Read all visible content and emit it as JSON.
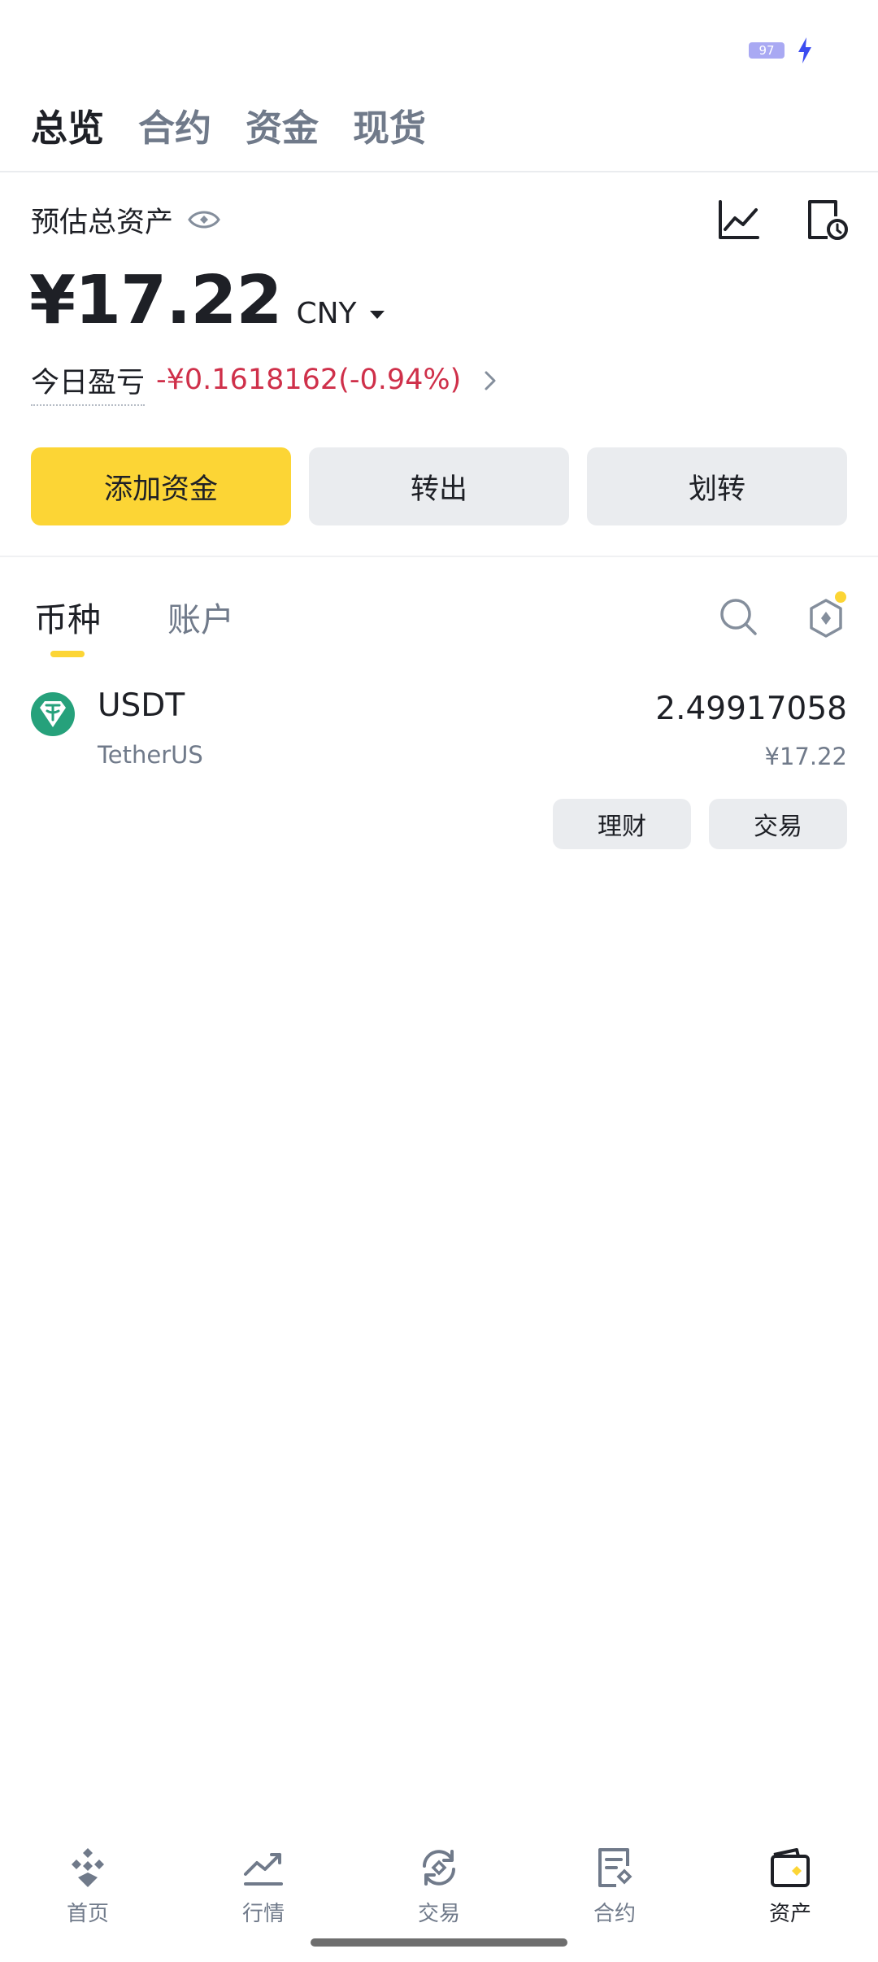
{
  "status_bar": {
    "battery": "97"
  },
  "top_tabs": [
    {
      "label": "总览",
      "active": true
    },
    {
      "label": "合约",
      "active": false
    },
    {
      "label": "资金",
      "active": false
    },
    {
      "label": "现货",
      "active": false
    }
  ],
  "overview": {
    "estimated_label": "预估总资产",
    "balance": "¥17.22",
    "currency": "CNY",
    "pnl_label": "今日盈亏",
    "pnl_value": "-¥0.1618162(-0.94%)"
  },
  "actions": {
    "add_funds": "添加资金",
    "withdraw": "转出",
    "transfer": "划转"
  },
  "sub_tabs": [
    {
      "label": "币种",
      "active": true
    },
    {
      "label": "账户",
      "active": false
    }
  ],
  "coins": [
    {
      "symbol": "USDT",
      "name": "TetherUS",
      "amount": "2.49917058",
      "value": "¥17.22",
      "earn_label": "理财",
      "trade_label": "交易"
    }
  ],
  "bottom_nav": [
    {
      "label": "首页",
      "icon": "home-icon",
      "active": false
    },
    {
      "label": "行情",
      "icon": "markets-icon",
      "active": false
    },
    {
      "label": "交易",
      "icon": "trade-icon",
      "active": false
    },
    {
      "label": "合约",
      "icon": "futures-icon",
      "active": false
    },
    {
      "label": "资产",
      "icon": "wallet-icon",
      "active": true
    }
  ],
  "colors": {
    "accent": "#fcd535",
    "negative": "#cf304a",
    "text_primary": "#1e2026",
    "text_secondary": "#707a8a",
    "button_bg": "#eaecef"
  }
}
